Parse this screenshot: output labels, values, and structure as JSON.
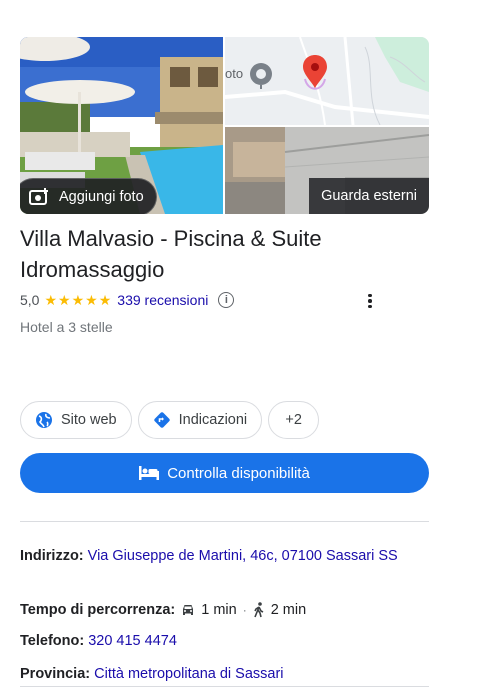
{
  "photos": {
    "add_photo_label": "Aggiungi foto",
    "exterior_label": "Guarda esterni",
    "map_fragment": "oto"
  },
  "place": {
    "name": "Villa Malvasio - Piscina & Suite Idromassaggio",
    "rating": "5,0",
    "stars": 5,
    "reviews": "339 recensioni",
    "category": "Hotel a 3 stelle"
  },
  "actions": {
    "website": "Sito web",
    "directions": "Indicazioni",
    "more": "+2",
    "cta": "Controlla disponibilità"
  },
  "details": {
    "address_label": "Indirizzo:",
    "address_value": "Via Giuseppe de Martini, 46c, 07100 Sassari SS",
    "travel_label": "Tempo di percorrenza:",
    "travel_car": "1 min",
    "travel_walk": "2 min",
    "phone_label": "Telefono:",
    "phone_value": "320 415 4474",
    "province_label": "Provincia:",
    "province_value": "Città metropolitana di Sassari"
  },
  "colors": {
    "accent": "#1a73e8",
    "link": "#1a0dab",
    "star": "#fbbc04",
    "pin": "#ea4335"
  }
}
